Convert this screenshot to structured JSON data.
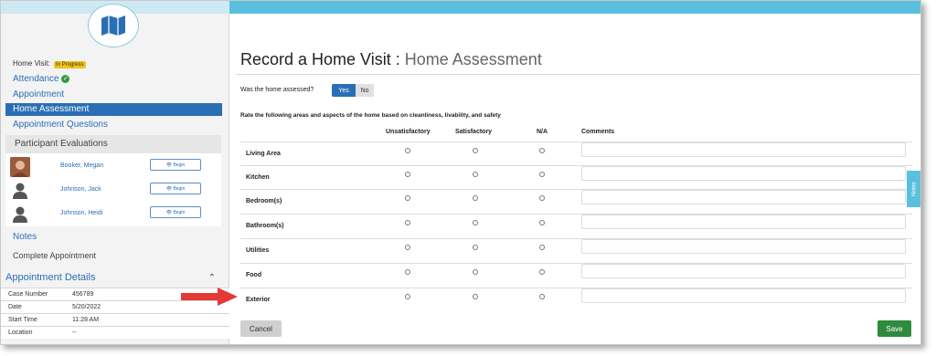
{
  "sidebar": {
    "home_visit_label": "Home Visit:",
    "status_badge": "In Progress",
    "nav": {
      "attendance": "Attendance",
      "appointment": "Appointment",
      "home_assessment": "Home Assessment",
      "appointment_questions": "Appointment Questions"
    },
    "participant_evaluations": {
      "heading": "Participant Evaluations",
      "participants": [
        {
          "name": "Booker, Megan",
          "button": "Begin",
          "avatar": "photo"
        },
        {
          "name": "Johnson, Jack",
          "button": "Begin",
          "avatar": "person-icon"
        },
        {
          "name": "Johnson, Heidi",
          "button": "Begin",
          "avatar": "person-icon"
        }
      ]
    },
    "notes": "Notes",
    "complete_appointment": "Complete Appointment",
    "appointment_details": {
      "heading": "Appointment Details",
      "rows": [
        {
          "key": "Case Number",
          "value": "456789"
        },
        {
          "key": "Date",
          "value": "5/20/2022"
        },
        {
          "key": "Start Time",
          "value": "11:28 AM"
        },
        {
          "key": "Location",
          "value": "--"
        }
      ]
    }
  },
  "main": {
    "title": "Record a Home Visit :",
    "subtitle": "Home Assessment",
    "assessed_question": "Was the home assessed?",
    "yes_label": "Yes",
    "no_label": "No",
    "rating_instruction": "Rate the following areas and aspects of the home based on cleanliness, livability, and safety",
    "columns": [
      "Unsatisfactory",
      "Satisfactory",
      "N/A",
      "Comments"
    ],
    "areas": [
      "Living Area",
      "Kitchen",
      "Bedroom(s)",
      "Bathroom(s)",
      "Utilities",
      "Food",
      "Exterior"
    ],
    "cancel_label": "Cancel",
    "save_label": "Save"
  },
  "notes_tab": "Notes",
  "colors": {
    "topbar": "#5bc0de",
    "primary": "#2a6fb5",
    "save": "#2e8b3d",
    "badge": "#f0c419",
    "arrow": "#e53935"
  }
}
